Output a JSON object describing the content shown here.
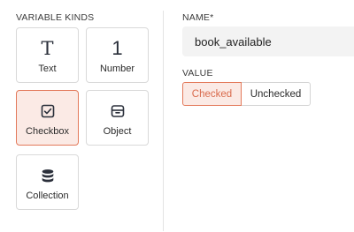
{
  "variable_kinds": {
    "label": "VARIABLE KINDS",
    "tiles": [
      {
        "label": "Text",
        "icon": "text-T-icon"
      },
      {
        "label": "Number",
        "icon": "number-1-icon"
      },
      {
        "label": "Checkbox",
        "icon": "checkbox-icon",
        "selected": true
      },
      {
        "label": "Object",
        "icon": "object-icon"
      },
      {
        "label": "Collection",
        "icon": "database-icon"
      }
    ],
    "glyph_text": "T",
    "glyph_number": "1"
  },
  "name": {
    "label": "NAME*",
    "value": "book_available"
  },
  "value": {
    "label": "VALUE",
    "options": [
      "Checked",
      "Unchecked"
    ],
    "selected": "Checked"
  },
  "colors": {
    "accent": "#e3795a",
    "accent_bg": "#fbeae5",
    "accent_text": "#d96a4c"
  }
}
